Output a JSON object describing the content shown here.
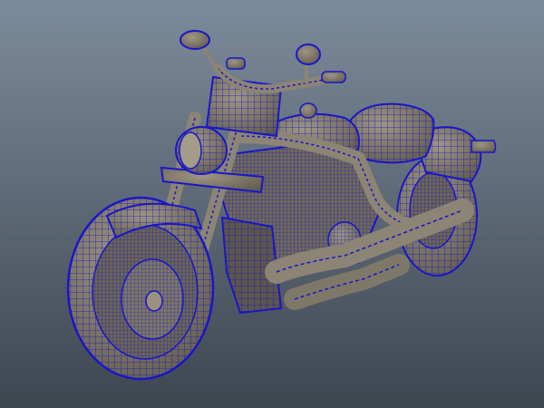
{
  "viewport": {
    "background_top": "#7c8b9b",
    "background_bottom": "#3e4650",
    "shading_mode": "wireframe-on-shaded"
  },
  "model": {
    "type": "motorcycle",
    "surface_color": "#8c8474",
    "surface_dark": "#5c564c",
    "wire_color": "#1a16c8",
    "wire_bright": "#2f2aff"
  }
}
